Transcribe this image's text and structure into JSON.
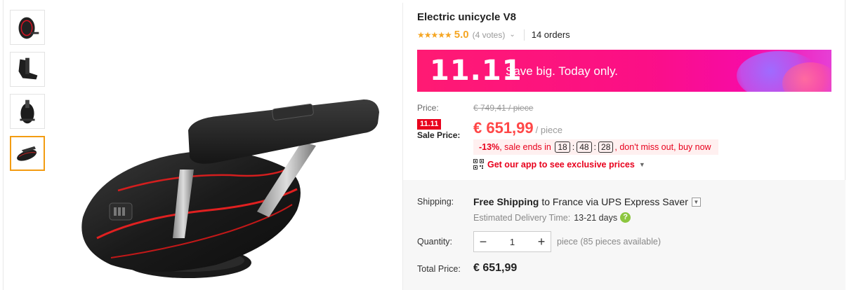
{
  "product": {
    "title": "Electric unicycle V8",
    "stars": "★★★★★",
    "score": "5.0",
    "votes": "(4 votes)",
    "orders": "14 orders"
  },
  "banner": {
    "event": "11.11",
    "tagline": "Save big. Today only."
  },
  "price": {
    "label": "Price:",
    "original": "€ 749,41 / piece",
    "badge": "11.11",
    "sale_label": "Sale Price:",
    "sale": "€ 651,99",
    "unit": "/ piece",
    "discount": "-13%",
    "ends_text": ", sale ends in",
    "timer": {
      "hours": "18",
      "minutes": "48",
      "seconds": "28"
    },
    "urgency": ", don't miss out, buy now",
    "app_promo": "Get our app to see exclusive prices"
  },
  "shipping": {
    "label": "Shipping:",
    "free": "Free Shipping",
    "destination": "to France via UPS Express Saver",
    "delivery_label": "Estimated Delivery Time:",
    "delivery_days": "13-21 days",
    "help_glyph": "?"
  },
  "quantity": {
    "label": "Quantity:",
    "value": "1",
    "availability": "piece (85 pieces available)",
    "minus": "−",
    "plus": "+"
  },
  "total": {
    "label": "Total Price:",
    "value": "€ 651,99"
  },
  "colors": {
    "accent_orange": "#f5a623",
    "sale_red": "#ff4747",
    "badge_red": "#e8001c",
    "banner_pink": "#fb0f86",
    "selected_thumb": "#f39c12"
  },
  "icons": [
    "star-icon",
    "chevron-down-icon",
    "qr-code-icon",
    "caret-down-icon",
    "help-icon",
    "minus-icon",
    "plus-icon"
  ]
}
